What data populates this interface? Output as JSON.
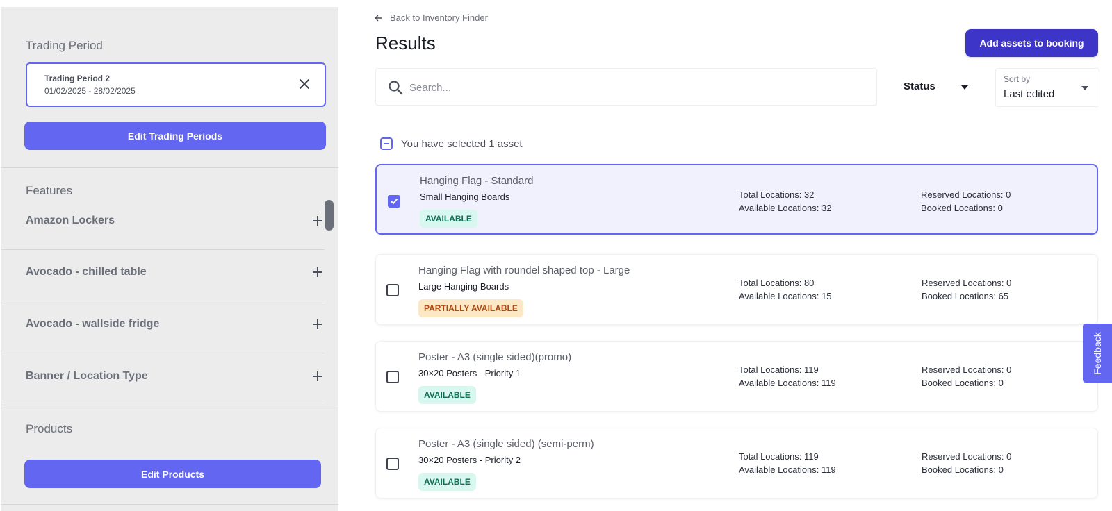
{
  "sidebar": {
    "trading_period": {
      "title": "Trading Period",
      "selected_name": "Trading Period 2",
      "selected_dates": "01/02/2025 - 28/02/2025",
      "edit_button": "Edit Trading Periods"
    },
    "features": {
      "title": "Features",
      "items": [
        {
          "label": "Amazon Lockers"
        },
        {
          "label": "Avocado - chilled table"
        },
        {
          "label": "Avocado - wallside fridge"
        },
        {
          "label": "Banner / Location Type"
        }
      ]
    },
    "products": {
      "title": "Products",
      "edit_button": "Edit Products"
    }
  },
  "main": {
    "back_link": "Back to Inventory Finder",
    "title": "Results",
    "add_button": "Add assets to booking",
    "search": {
      "placeholder": "Search...",
      "value": ""
    },
    "status_filter": {
      "label": "Status"
    },
    "sort": {
      "caption": "Sort by",
      "value": "Last edited"
    },
    "selection_text": "You have selected 1 asset",
    "assets": [
      {
        "name": "Hanging Flag - Standard",
        "category": "Small Hanging Boards",
        "status": "AVAILABLE",
        "selected": true,
        "total": "Total Locations: 32",
        "available": "Available Locations: 32",
        "reserved": "Reserved Locations: 0",
        "booked": "Booked Locations: 0"
      },
      {
        "name": "Hanging Flag with roundel shaped top - Large",
        "category": "Large Hanging Boards",
        "status": "PARTIALLY AVAILABLE",
        "selected": false,
        "total": "Total Locations: 80",
        "available": "Available Locations: 15",
        "reserved": "Reserved Locations: 0",
        "booked": "Booked Locations: 65"
      },
      {
        "name": "Poster - A3 (single sided)(promo)",
        "category": "30×20 Posters - Priority 1",
        "status": "AVAILABLE",
        "selected": false,
        "total": "Total Locations: 119",
        "available": "Available Locations: 119",
        "reserved": "Reserved Locations: 0",
        "booked": "Booked Locations: 0"
      },
      {
        "name": "Poster - A3 (single sided) (semi-perm)",
        "category": "30×20 Posters - Priority 2",
        "status": "AVAILABLE",
        "selected": false,
        "total": "Total Locations: 119",
        "available": "Available Locations: 119",
        "reserved": "Reserved Locations: 0",
        "booked": "Booked Locations: 0"
      }
    ]
  },
  "feedback_label": "Feedback",
  "icons": {
    "back": "arrow-left-icon",
    "close": "close-icon",
    "plus": "plus-icon",
    "search": "search-icon",
    "caret": "caret-down-icon",
    "check": "check-icon"
  },
  "colors": {
    "accent": "#6366f1",
    "add_button": "#3d34c8",
    "available_bg": "#d8f7ef",
    "available_text": "#0f6e52",
    "partial_bg": "#fde8c6",
    "partial_text": "#b04a10",
    "sidebar_bg": "#ececec"
  }
}
